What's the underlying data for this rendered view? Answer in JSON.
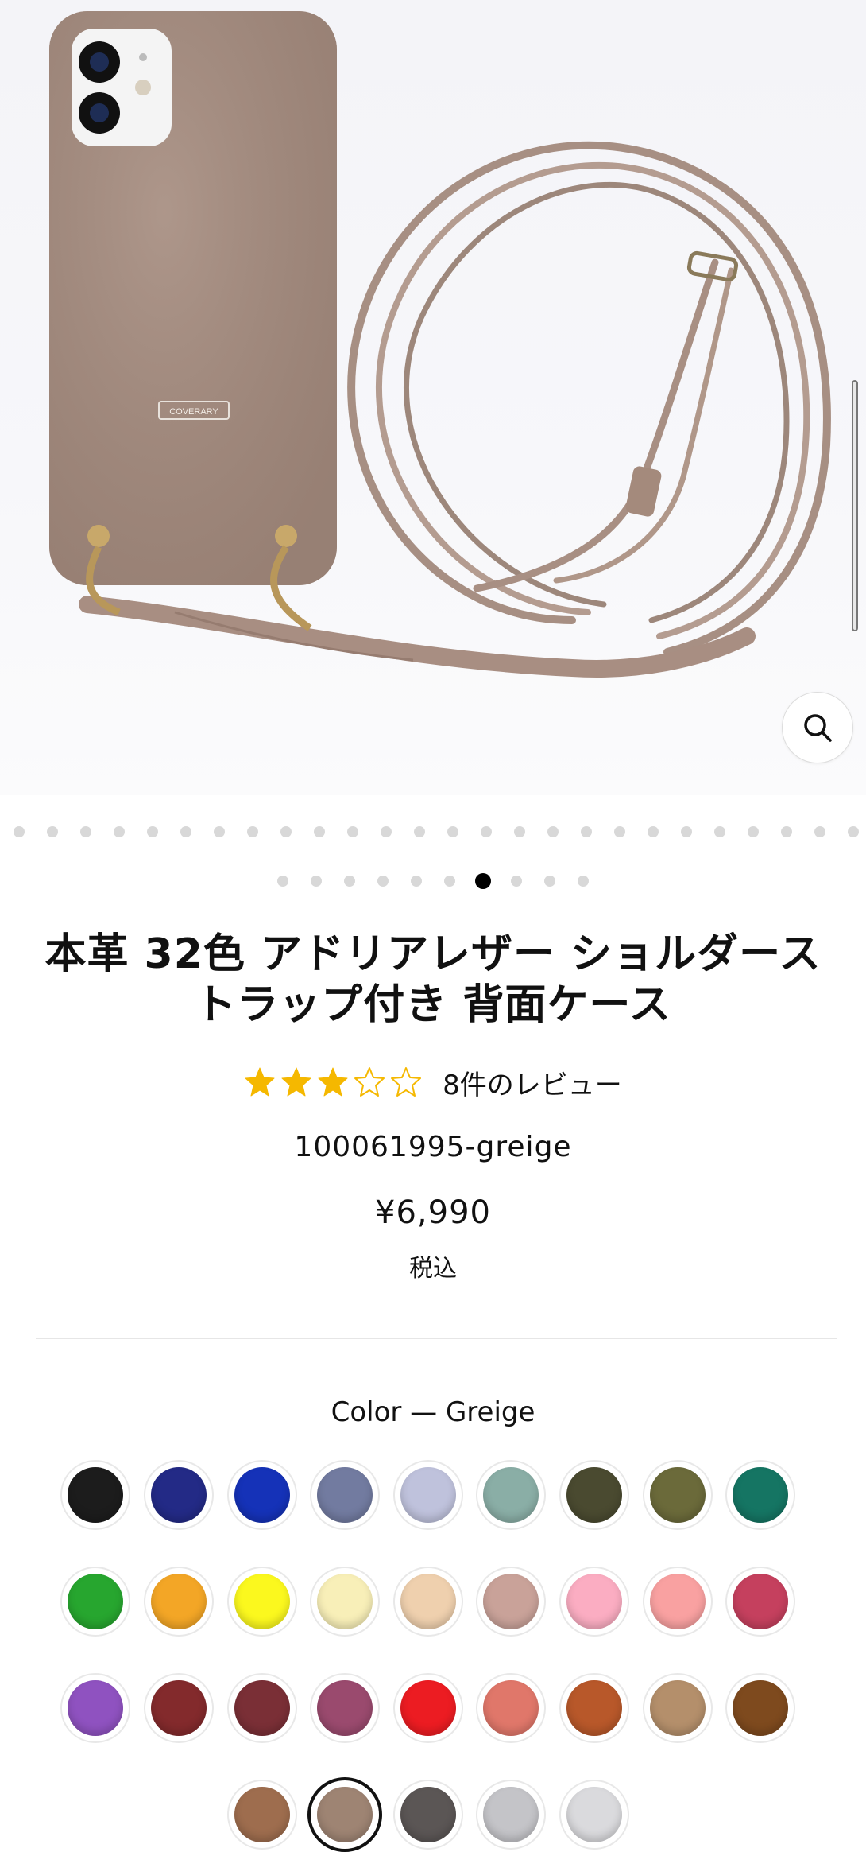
{
  "product": {
    "title_line1": "本革 32色 アドリアレザー ショルダース",
    "title_line2": "トラップ付き 背面ケース",
    "rating": 3,
    "rating_max": 5,
    "review_count_label": "8件のレビュー",
    "sku": "100061995-greige",
    "price": "¥6,990",
    "tax_label": "税込",
    "logo_text": "COVERARY"
  },
  "gallery": {
    "total_images": 36,
    "active_index": 32,
    "zoom_icon": "search-icon"
  },
  "color": {
    "label": "Color — Greige",
    "selected_index": 28,
    "swatches": [
      {
        "color": "#1c1c1c"
      },
      {
        "color": "#232a86"
      },
      {
        "color": "#1532b8"
      },
      {
        "color": "#727ba0"
      },
      {
        "color": "#bfc2dc"
      },
      {
        "color": "#8aaea6"
      },
      {
        "color": "#4a4a30"
      },
      {
        "color": "#6b6a3a"
      },
      {
        "color": "#157563"
      },
      {
        "color": "#27a62f"
      },
      {
        "color": "#f3a626"
      },
      {
        "color": "#fbf81e"
      },
      {
        "color": "#f8efb8"
      },
      {
        "color": "#efd0ae"
      },
      {
        "color": "#c9a299"
      },
      {
        "color": "#fbadc2"
      },
      {
        "color": "#f9a1a1"
      },
      {
        "color": "#c5405e"
      },
      {
        "color": "#8f52c0"
      },
      {
        "color": "#832a2c"
      },
      {
        "color": "#7a2f36"
      },
      {
        "color": "#9a4a6e"
      },
      {
        "color": "#ec1c22"
      },
      {
        "color": "#e0776a"
      },
      {
        "color": "#b8582a"
      },
      {
        "color": "#b48f6b"
      },
      {
        "color": "#7e4a1e"
      },
      {
        "color": "#9e6d4e"
      },
      {
        "color": "#9e8473"
      },
      {
        "color": "#5b5655"
      },
      {
        "color": "#c4c4c8"
      },
      {
        "color": "#dadadd"
      }
    ]
  }
}
